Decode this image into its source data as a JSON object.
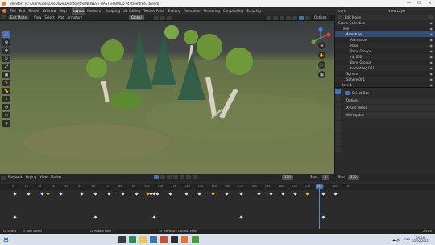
{
  "window": {
    "title": "Blender* [C:\\Users\\user\\OneDrive\\Desktop\\the NEWEST MASTER BUILD P4 \\tree\\tree3.blend]",
    "minimize_glyph": "—",
    "maximize_glyph": "☐",
    "close_glyph": "✕"
  },
  "menubar": {
    "menus": [
      "File",
      "Edit",
      "Render",
      "Window",
      "Help"
    ],
    "workspaces": [
      "Layout",
      "Modeling",
      "Sculpting",
      "UV Editing",
      "Texture Paint",
      "Shading",
      "Animation",
      "Rendering",
      "Compositing",
      "Scripting"
    ],
    "active_workspace": "Layout",
    "scene_label": "Scene",
    "view_layer_label": "View Layer"
  },
  "viewport_header": {
    "mode": "Edit Mode",
    "menus": [
      "View",
      "Select",
      "Add",
      "Armature"
    ],
    "transform_orientation": "Global",
    "options_label": "Options"
  },
  "outliner": {
    "mode_label": "Edit Mode",
    "rows": [
      {
        "label": "Scene Collection",
        "indent": 0,
        "selected": false
      },
      {
        "label": "Tree",
        "indent": 1,
        "selected": false
      },
      {
        "label": "Armature",
        "indent": 2,
        "selected": true
      },
      {
        "label": "Animation",
        "indent": 3,
        "selected": false
      },
      {
        "label": "Pose",
        "indent": 3,
        "selected": false
      },
      {
        "label": "Bone Groups",
        "indent": 3,
        "selected": false
      },
      {
        "label": "rig.002",
        "indent": 3,
        "selected": false
      },
      {
        "label": "Bone Groups",
        "indent": 3,
        "selected": false
      },
      {
        "label": "bucket leg.001",
        "indent": 3,
        "selected": false
      },
      {
        "label": "Sphere",
        "indent": 2,
        "selected": false
      },
      {
        "label": "Sphere.001",
        "indent": 2,
        "selected": false
      },
      {
        "label": "tree.1",
        "indent": 1,
        "selected": false
      }
    ]
  },
  "properties": {
    "tool_name": "Select Box",
    "panels": [
      "Options",
      "X-Axis Mirror",
      "Workspace"
    ]
  },
  "timeline": {
    "menus": [
      "Playback",
      "Keying",
      "View",
      "Marker"
    ],
    "current_frame": "170",
    "start_label": "Start",
    "start_value": "1",
    "end_label": "End",
    "end_value": "250",
    "playhead_frame": "231",
    "ruler_ticks": [
      "0",
      "10",
      "20",
      "30",
      "40",
      "50",
      "60",
      "70",
      "80",
      "90",
      "100",
      "110",
      "120",
      "130",
      "140",
      "150",
      "160",
      "170",
      "180",
      "190",
      "200",
      "210",
      "220",
      "230",
      "240",
      "250"
    ]
  },
  "statusbar": {
    "select": "Select",
    "box_select": "Box Select",
    "rotate_view": "Rotate View",
    "context_menu": "Armature Context Menu",
    "version": "2.91.0"
  },
  "taskbar": {
    "time": "20:18",
    "date": "12/02/2021",
    "language": "ENG"
  },
  "colors": {
    "accent": "#4772b3",
    "selected_key": "#e8b341",
    "playhead": "#4a8fe6"
  }
}
